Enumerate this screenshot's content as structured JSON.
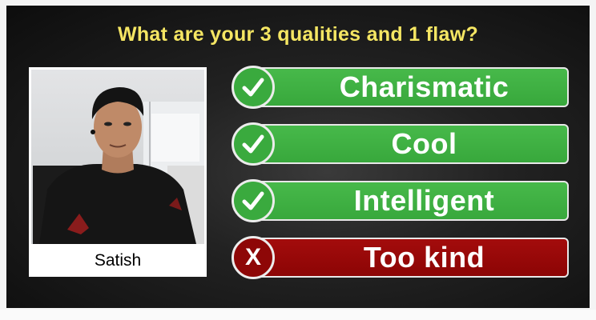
{
  "title": "What are your 3 qualities and 1 flaw?",
  "profile": {
    "name": "Satish",
    "photo_icon": "person-photo"
  },
  "answers": [
    {
      "label": "Charismatic",
      "kind": "quality",
      "icon": "check-icon",
      "color": "#3aaa3e"
    },
    {
      "label": "Cool",
      "kind": "quality",
      "icon": "check-icon",
      "color": "#3aaa3e"
    },
    {
      "label": "Intelligent",
      "kind": "quality",
      "icon": "check-icon",
      "color": "#3aaa3e"
    },
    {
      "label": "Too kind",
      "kind": "flaw",
      "icon": "x-icon",
      "color": "#8e0707"
    }
  ],
  "colors": {
    "title": "#f5e663",
    "quality": "#3aaa3e",
    "flaw": "#8e0707",
    "background": "#1a1a1a"
  }
}
